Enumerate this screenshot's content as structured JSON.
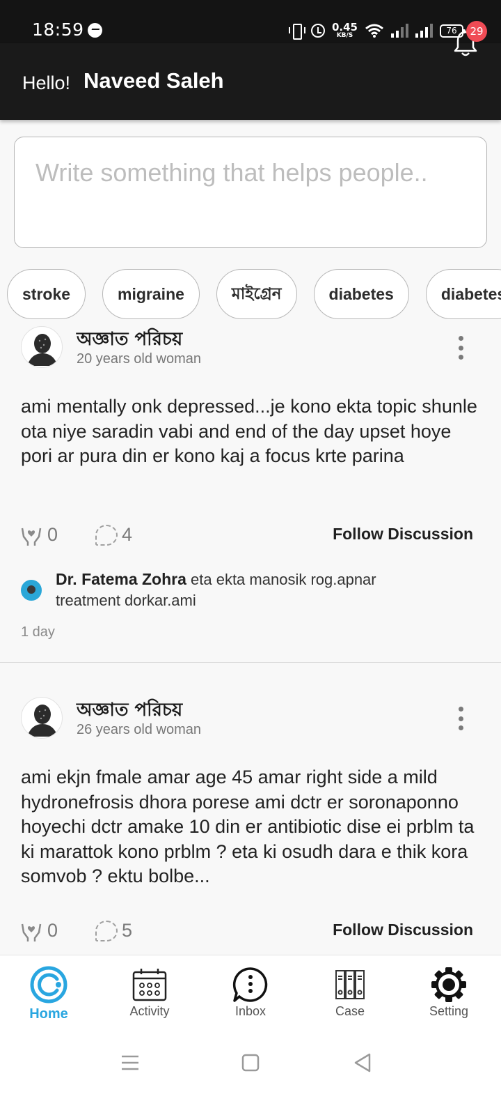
{
  "status_bar": {
    "time": "18:59",
    "net_speed_value": "0.45",
    "net_speed_unit": "KB/S",
    "battery": "76"
  },
  "header": {
    "greeting": "Hello!",
    "username": "Naveed Saleh",
    "notification_count": "29"
  },
  "composer": {
    "placeholder": "Write something that helps people.."
  },
  "chips": [
    "stroke",
    "migraine",
    "মাইগ্রেন",
    "diabetes",
    "diabetes"
  ],
  "posts": [
    {
      "author": "অজ্ঞাত পরিচয়",
      "subtitle": "20 years old woman",
      "text": "ami mentally onk depressed...je kono ekta topic shunle ota niye saradin vabi and end of the day upset hoye pori ar pura din er kono kaj a focus krte parina",
      "support_count": "0",
      "comment_count": "4",
      "follow_label": "Follow Discussion",
      "top_comment": {
        "author": "Dr. Fatema Zohra",
        "text": "eta ekta manosik rog.apnar treatment dorkar.ami"
      },
      "time": "1 day"
    },
    {
      "author": "অজ্ঞাত পরিচয়",
      "subtitle": "26 years old woman",
      "text": "ami ekjn fmale amar age 45 amar right side a mild hydronefrosis dhora porese ami dctr er soronaponno hoyechi dctr amake 10 din er antibiotic  dise ei prblm ta ki marattok kono prblm ? eta ki osudh dara e thik kora somvob ? ektu bolbe...",
      "support_count": "0",
      "comment_count": "5",
      "follow_label": "Follow Discussion"
    }
  ],
  "bottom_nav": [
    {
      "label": "Home",
      "icon": "home-icon",
      "active": true
    },
    {
      "label": "Activity",
      "icon": "calendar-icon",
      "active": false
    },
    {
      "label": "Inbox",
      "icon": "chat-icon",
      "active": false
    },
    {
      "label": "Case",
      "icon": "folders-icon",
      "active": false
    },
    {
      "label": "Setting",
      "icon": "gear-icon",
      "active": false
    }
  ],
  "colors": {
    "accent": "#29a6e0",
    "header_bg": "#1a1a1a",
    "badge": "#f04b55"
  }
}
